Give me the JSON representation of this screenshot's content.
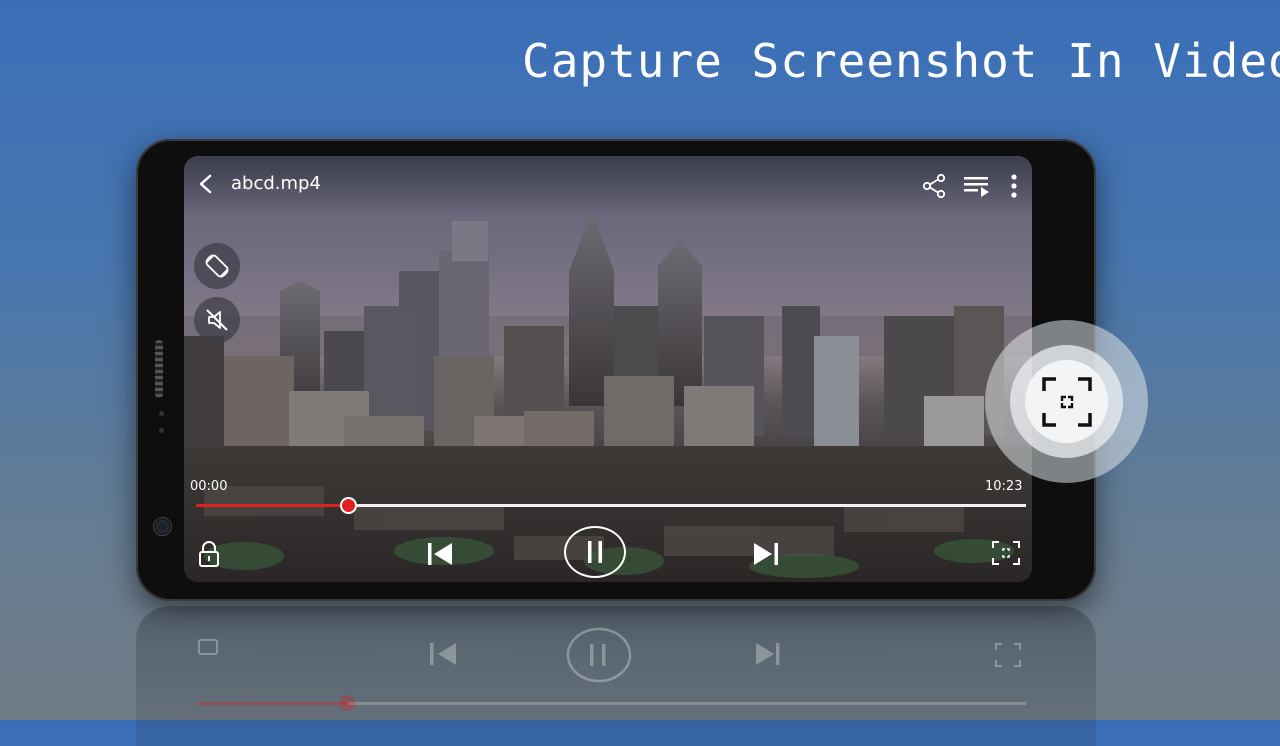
{
  "headline": "Capture Screenshot In Video",
  "player": {
    "filename": "abcd.mp4",
    "time_current": "00:00",
    "time_total": "10:23",
    "progress_fraction": 0.183,
    "accent_color": "#e02020"
  },
  "icons": {
    "back": "chevron-left-icon",
    "share": "share-icon",
    "playlist": "playlist-icon",
    "more": "more-vertical-icon",
    "rotate": "screen-rotation-icon",
    "mute": "volume-mute-icon",
    "lock": "lock-icon",
    "previous": "skip-previous-icon",
    "pause": "pause-icon",
    "next": "skip-next-icon",
    "screenshot": "screenshot-capture-icon"
  }
}
